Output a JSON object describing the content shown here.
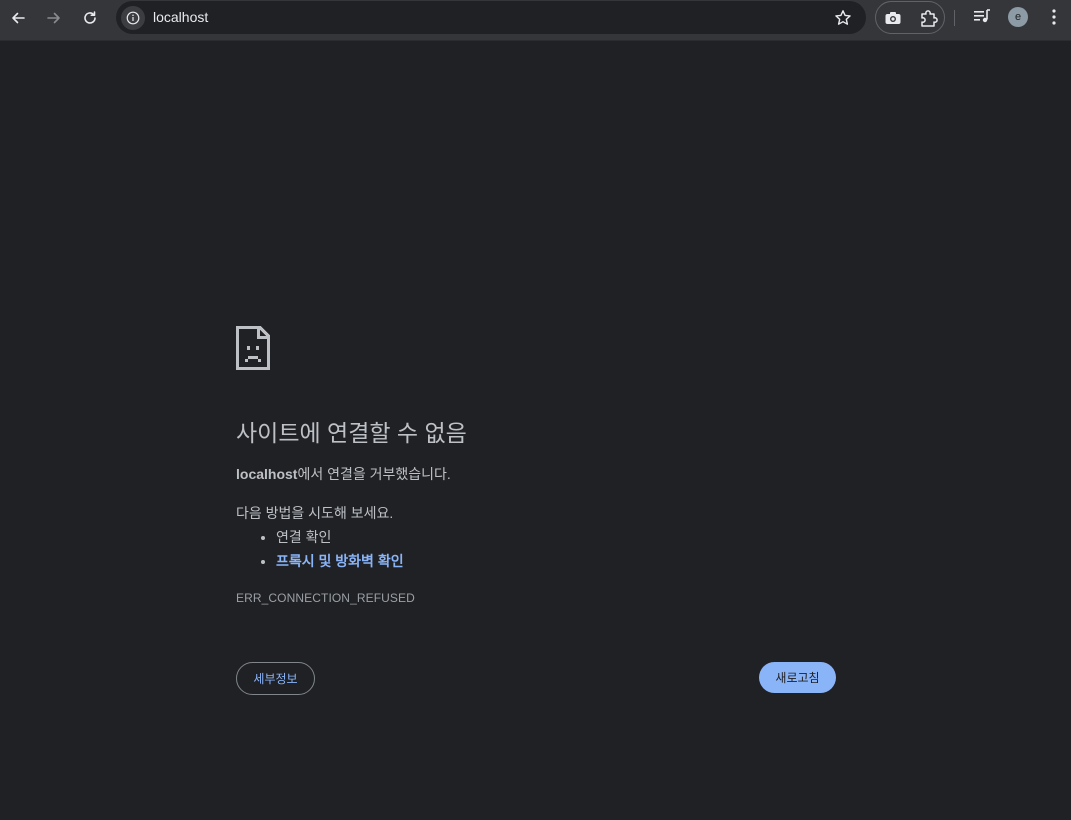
{
  "browser": {
    "url": "localhost",
    "avatar_initial": "e",
    "icons": {
      "back": "arrow-left-icon",
      "forward": "arrow-right-icon",
      "reload": "reload-icon",
      "site_info": "info-icon",
      "bookmark": "star-icon",
      "extension_1": "camera-icon",
      "extensions": "puzzle-icon",
      "media": "media-queue-icon",
      "menu": "kebab-menu-icon"
    }
  },
  "error_page": {
    "icon": "sad-page-icon",
    "title": "사이트에 연결할 수 없음",
    "summary_host": "localhost",
    "summary_rest": "에서 연결을 거부했습니다.",
    "try_text": "다음 방법을 시도해 보세요.",
    "suggestions": [
      {
        "label": "연결 확인",
        "is_link": false
      },
      {
        "label": "프록시 및 방화벽 확인",
        "is_link": true
      }
    ],
    "error_code": "ERR_CONNECTION_REFUSED",
    "details_button": "세부정보",
    "reload_button": "새로고침"
  },
  "colors": {
    "page_background": "#202124",
    "toolbar": "#35363a",
    "text": "#bdc1c6",
    "link": "#8ab4f8",
    "primary_button": "#8ab4f8"
  }
}
